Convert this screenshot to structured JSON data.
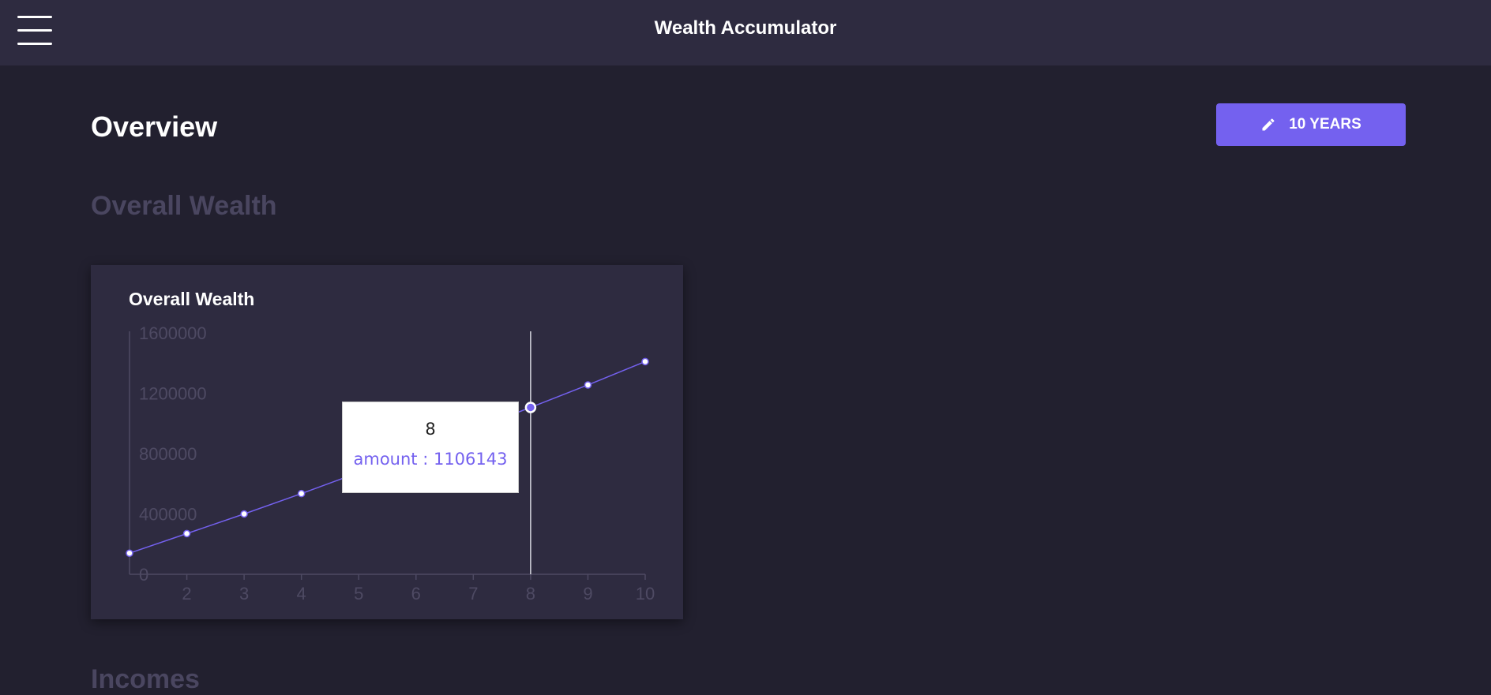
{
  "header": {
    "title": "Wealth Accumulator",
    "menu_icon": "hamburger-menu-icon"
  },
  "page": {
    "title": "Overview",
    "years_button": {
      "icon": "pencil-icon",
      "label": "10 YEARS"
    },
    "sections": [
      "Overall Wealth",
      "Incomes"
    ]
  },
  "colors": {
    "background": "#22202f",
    "panel": "#2e2b40",
    "accent": "#7461ef",
    "muted_text": "#4a4660"
  },
  "chart_data": {
    "type": "line",
    "title": "Overall Wealth",
    "x": [
      1,
      2,
      3,
      4,
      5,
      6,
      7,
      8,
      9,
      10
    ],
    "x_tick_labels": [
      "2",
      "3",
      "4",
      "5",
      "6",
      "7",
      "8",
      "9",
      "10"
    ],
    "y_tick_labels": [
      "0",
      "400000",
      "800000",
      "1200000",
      "1600000"
    ],
    "ylim": [
      0,
      1600000
    ],
    "series": [
      {
        "name": "amount",
        "values": [
          140000,
          270000,
          400000,
          535000,
          675000,
          820000,
          960000,
          1106143,
          1255000,
          1410000
        ]
      }
    ],
    "grid": false,
    "tooltip": {
      "x": "8",
      "series": "amount",
      "text": "amount : 1106143"
    }
  }
}
